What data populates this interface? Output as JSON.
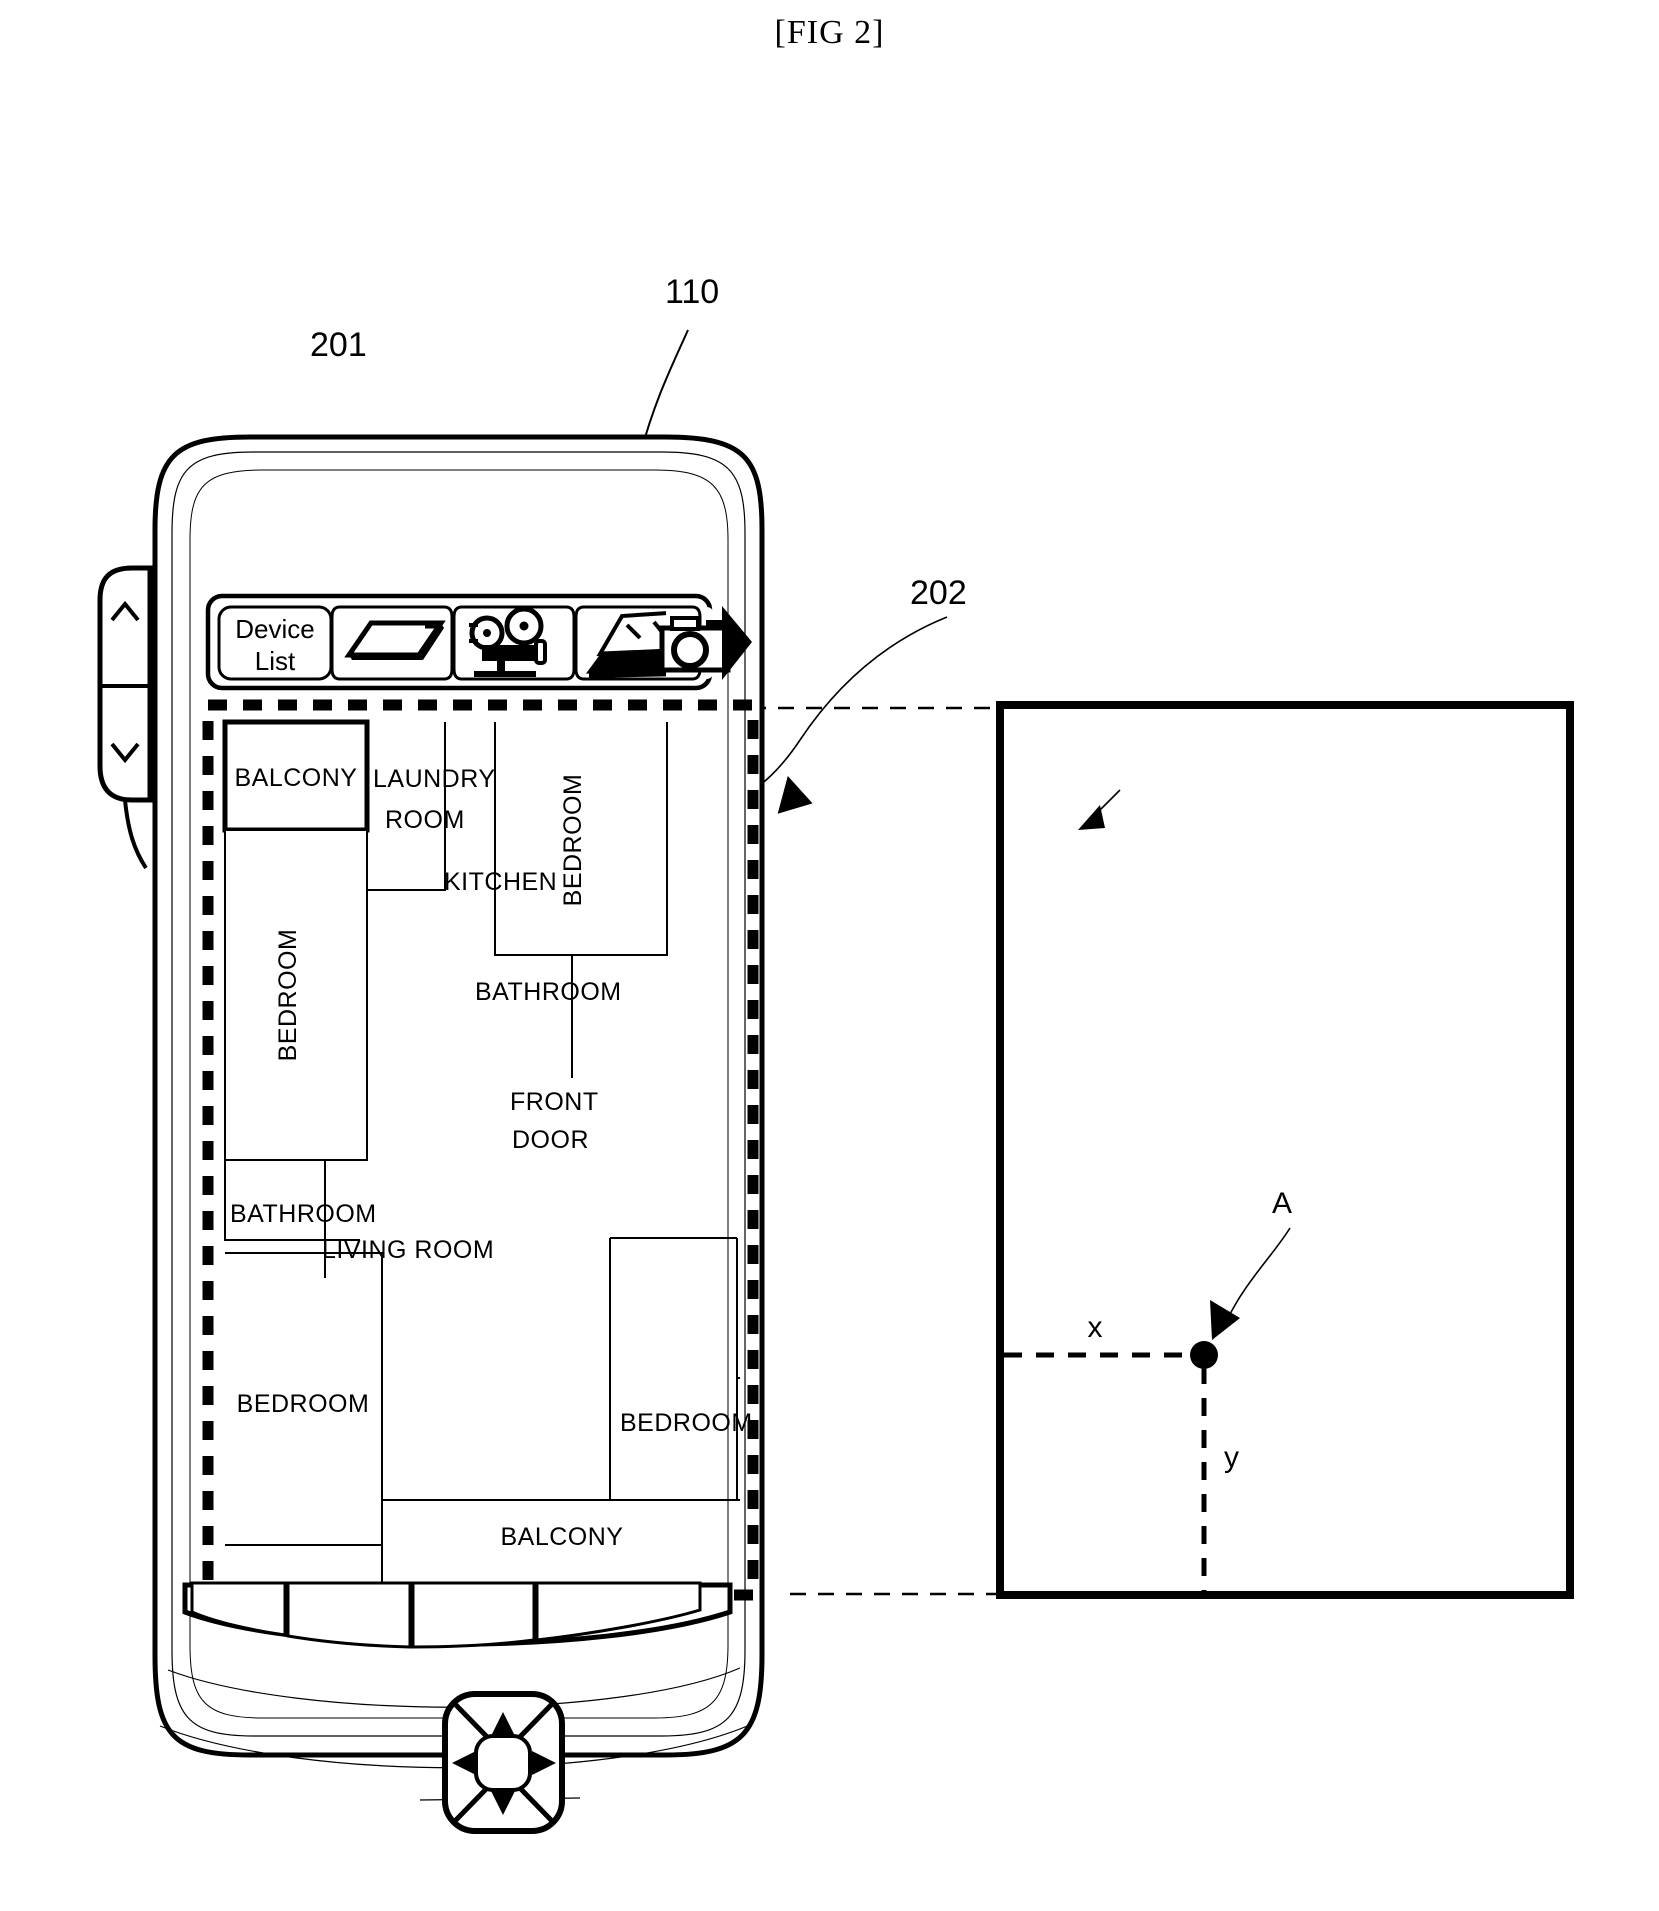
{
  "figure": {
    "title": "[FIG 2]",
    "reference_numbers": [
      {
        "id": "110",
        "label": "110",
        "target": "mobile-device"
      },
      {
        "id": "201",
        "label": "201",
        "target": "toolbar"
      },
      {
        "id": "202",
        "label": "202",
        "target": "display-region"
      }
    ]
  },
  "device": {
    "toolbar": {
      "device_list_button": {
        "line1": "Device",
        "line2": "List"
      },
      "icons": [
        {
          "name": "tablet-icon",
          "label": "tablet"
        },
        {
          "name": "projector-icon",
          "label": "projector"
        },
        {
          "name": "laptop-icon",
          "label": "laptop"
        },
        {
          "name": "camera-icon",
          "label": "camera"
        }
      ],
      "more_arrow": {
        "name": "next-arrow-icon",
        "label": "next"
      }
    },
    "side_keys": [
      {
        "name": "scroll-up-key",
        "glyph": "up"
      },
      {
        "name": "scroll-down-key",
        "glyph": "down"
      }
    ],
    "soft_keys": [
      {
        "name": "soft-key-1",
        "label": ""
      },
      {
        "name": "soft-key-2",
        "label": ""
      },
      {
        "name": "soft-key-3",
        "label": ""
      },
      {
        "name": "soft-key-4",
        "label": ""
      }
    ],
    "dpad": {
      "name": "direction-pad",
      "keys": [
        "up",
        "down",
        "left",
        "right",
        "center"
      ]
    }
  },
  "floorplan": {
    "rooms": [
      {
        "name": "balcony-top",
        "label": "BALCONY"
      },
      {
        "name": "laundry-room",
        "label": "LAUNDRY\nROOM",
        "line1": "LAUNDRY",
        "line2": "ROOM"
      },
      {
        "name": "kitchen",
        "label": "KITCHEN"
      },
      {
        "name": "bedroom-right-top",
        "label": "BEDROOM"
      },
      {
        "name": "bedroom-left",
        "label": "BEDROOM"
      },
      {
        "name": "bathroom-right",
        "label": "BATHROOM"
      },
      {
        "name": "front-door",
        "label": "FRONT\nDOOR",
        "line1": "FRONT",
        "line2": "DOOR"
      },
      {
        "name": "bathroom-left",
        "label": "BATHROOM"
      },
      {
        "name": "living-room",
        "label": "LIVING ROOM"
      },
      {
        "name": "bedroom-bottom-left",
        "label": "BEDROOM"
      },
      {
        "name": "bedroom-bottom-right",
        "label": "BEDROOM"
      },
      {
        "name": "balcony-bottom",
        "label": "BALCONY"
      }
    ]
  },
  "coordinate_panel": {
    "point_label": "A",
    "x_label": "x",
    "y_label": "y"
  }
}
